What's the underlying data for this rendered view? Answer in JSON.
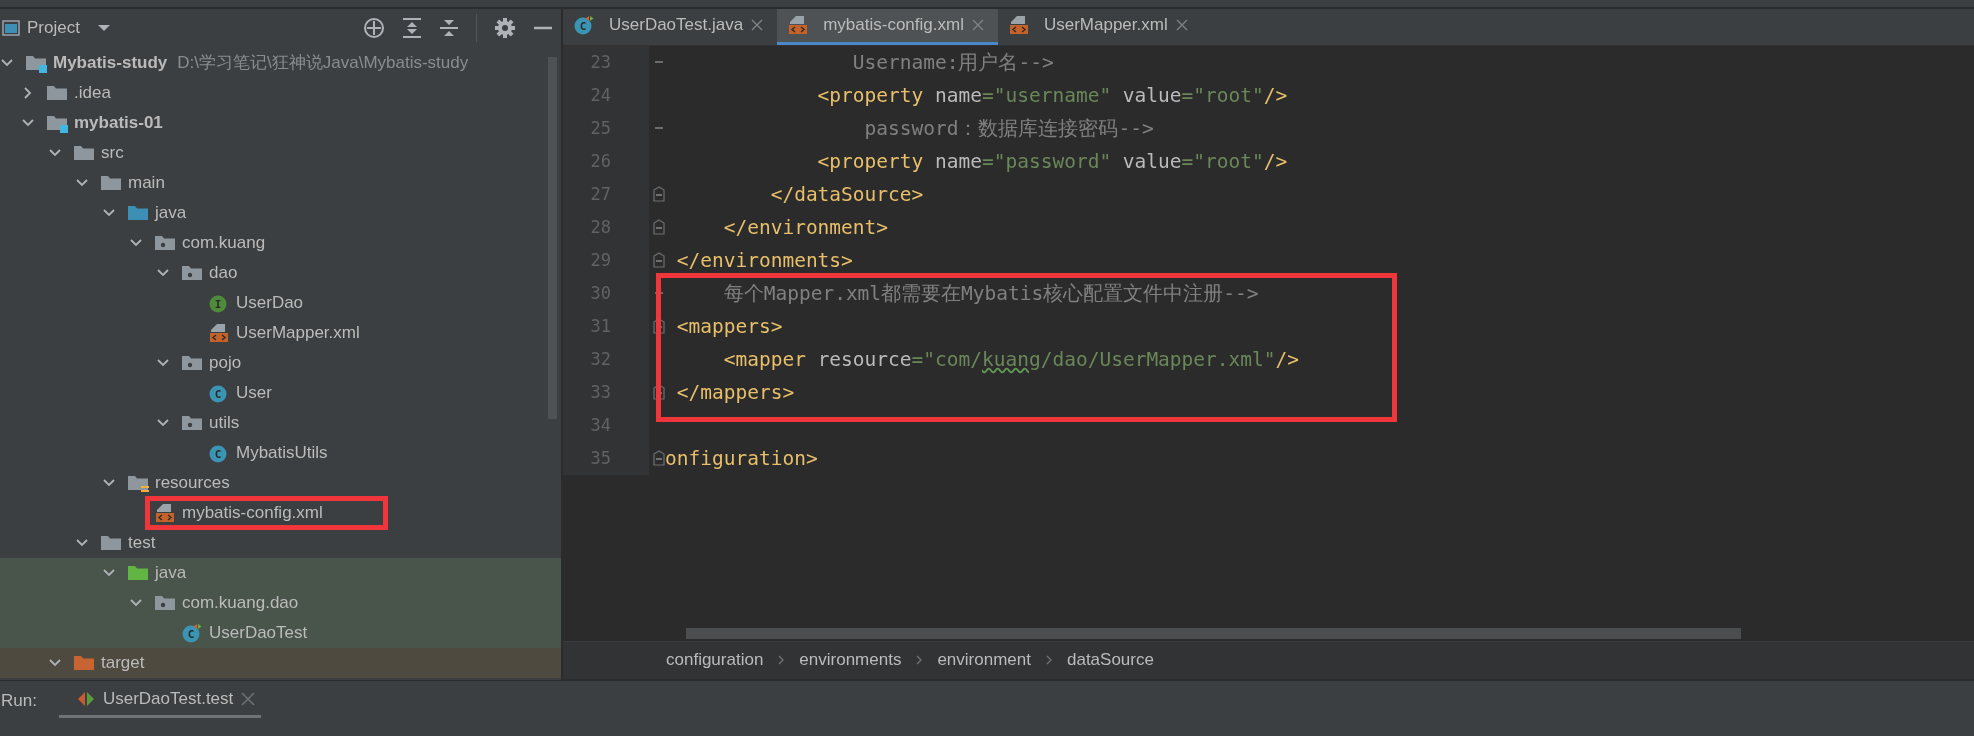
{
  "project_panel": {
    "title": "Project",
    "tree": [
      {
        "name": "Mybatis-study",
        "path": "D:\\学习笔记\\狂神说Java\\Mybatis-study",
        "kind": "module",
        "expanded": true,
        "children": [
          {
            "name": ".idea",
            "kind": "folder",
            "expanded": false
          },
          {
            "name": "mybatis-01",
            "kind": "module",
            "expanded": true,
            "children": [
              {
                "name": "src",
                "kind": "folder",
                "expanded": true,
                "children": [
                  {
                    "name": "main",
                    "kind": "folder",
                    "expanded": true,
                    "children": [
                      {
                        "name": "java",
                        "kind": "source-folder",
                        "expanded": true,
                        "children": [
                          {
                            "name": "com.kuang",
                            "kind": "package",
                            "expanded": true,
                            "children": [
                              {
                                "name": "dao",
                                "kind": "package",
                                "expanded": true,
                                "children": [
                                  {
                                    "name": "UserDao",
                                    "kind": "interface",
                                    "icon_text": "I"
                                  },
                                  {
                                    "name": "UserMapper.xml",
                                    "kind": "xml"
                                  }
                                ]
                              },
                              {
                                "name": "pojo",
                                "kind": "package",
                                "expanded": true,
                                "children": [
                                  {
                                    "name": "User",
                                    "kind": "class",
                                    "icon_text": "C"
                                  }
                                ]
                              },
                              {
                                "name": "utils",
                                "kind": "package",
                                "expanded": true,
                                "children": [
                                  {
                                    "name": "MybatisUtils",
                                    "kind": "class",
                                    "icon_text": "C"
                                  }
                                ]
                              }
                            ]
                          }
                        ]
                      },
                      {
                        "name": "resources",
                        "kind": "resource-folder",
                        "expanded": true,
                        "children": [
                          {
                            "name": "mybatis-config.xml",
                            "kind": "xml",
                            "highlighted": true
                          }
                        ]
                      }
                    ]
                  },
                  {
                    "name": "test",
                    "kind": "folder",
                    "expanded": true,
                    "children": [
                      {
                        "name": "java",
                        "kind": "test-folder",
                        "color": "#49544a",
                        "expanded": true,
                        "children": [
                          {
                            "name": "com.kuang.dao",
                            "kind": "package",
                            "color": "#49544a",
                            "expanded": true,
                            "children": [
                              {
                                "name": "UserDaoTest",
                                "kind": "test-class",
                                "icon_text": "C",
                                "color": "#49544a"
                              }
                            ]
                          }
                        ]
                      }
                    ]
                  }
                ]
              },
              {
                "name": "target",
                "kind": "excluded-folder",
                "color": "#4f4a3f",
                "expanded": true
              }
            ]
          }
        ]
      }
    ]
  },
  "tabs": [
    {
      "label": "UserDaoTest.java",
      "kind": "test-class",
      "icon_text": "C",
      "selected": false
    },
    {
      "label": "mybatis-config.xml",
      "kind": "xml",
      "selected": true
    },
    {
      "label": "UserMapper.xml",
      "kind": "xml",
      "selected": false
    }
  ],
  "code": {
    "lines": [
      {
        "number": "23",
        "kind": "dash",
        "highlighted": false,
        "tokens": [
          {
            "kind": "comment",
            "text": "                Username:用户名-->"
          }
        ]
      },
      {
        "number": "24",
        "kind": "plain",
        "highlighted": false,
        "tokens": [
          {
            "kind": "tag",
            "text": "             <property"
          },
          {
            "kind": "attr",
            "text": " name"
          },
          {
            "kind": "string",
            "text": "=\"username\""
          },
          {
            "kind": "attr",
            "text": " value"
          },
          {
            "kind": "string",
            "text": "=\"root\""
          },
          {
            "kind": "tag",
            "text": "/>"
          }
        ]
      },
      {
        "number": "25",
        "kind": "dash",
        "highlighted": false,
        "tokens": [
          {
            "kind": "comment",
            "text": "                 password：数据库连接密码-->"
          }
        ]
      },
      {
        "number": "26",
        "kind": "plain",
        "highlighted": false,
        "tokens": [
          {
            "kind": "tag",
            "text": "             <property"
          },
          {
            "kind": "attr",
            "text": " name"
          },
          {
            "kind": "string",
            "text": "=\"password\""
          },
          {
            "kind": "attr",
            "text": " value"
          },
          {
            "kind": "string",
            "text": "=\"root\""
          },
          {
            "kind": "tag",
            "text": "/>"
          }
        ]
      },
      {
        "number": "27",
        "kind": "fold",
        "highlighted": false,
        "tokens": [
          {
            "kind": "tag",
            "text": "         </dataSource>"
          }
        ]
      },
      {
        "number": "28",
        "kind": "fold",
        "highlighted": false,
        "tokens": [
          {
            "kind": "tag",
            "text": "     </environment>"
          }
        ]
      },
      {
        "number": "29",
        "kind": "fold",
        "highlighted": false,
        "tokens": [
          {
            "kind": "tag",
            "text": " </environments>"
          }
        ]
      },
      {
        "number": "30",
        "kind": "dash",
        "highlighted": true,
        "tokens": [
          {
            "kind": "comment",
            "text": "     每个Mapper.xml都需要在Mybatis核心配置文件中注册-->"
          }
        ]
      },
      {
        "number": "31",
        "kind": "fold",
        "highlighted": true,
        "tokens": [
          {
            "kind": "tag",
            "text": " <mappers>"
          }
        ]
      },
      {
        "number": "32",
        "kind": "plain",
        "highlighted": true,
        "tokens": [
          {
            "kind": "tag",
            "text": "     <mapper"
          },
          {
            "kind": "attr",
            "text": " resource"
          },
          {
            "kind": "string",
            "text": "=\"com/"
          },
          {
            "kind": "typo",
            "text": "kuang"
          },
          {
            "kind": "string",
            "text": "/dao/UserMapper.xml\""
          },
          {
            "kind": "tag",
            "text": "/>"
          }
        ]
      },
      {
        "number": "33",
        "kind": "fold",
        "highlighted": true,
        "tokens": [
          {
            "kind": "tag",
            "text": " </mappers>"
          }
        ]
      },
      {
        "number": "34",
        "kind": "plain",
        "highlighted": false
      },
      {
        "number": "35",
        "kind": "fold",
        "highlighted": false,
        "tokens": [
          {
            "kind": "tag",
            "text": "onfiguration>"
          }
        ]
      }
    ]
  },
  "breadcrumb": [
    "configuration",
    "environments",
    "environment",
    "dataSource"
  ],
  "run_bar": {
    "label": "Run:",
    "tab": "UserDaoTest.test"
  }
}
